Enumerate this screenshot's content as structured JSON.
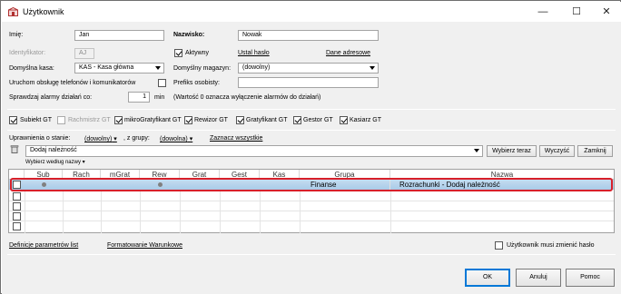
{
  "window": {
    "title": "Użytkownik",
    "minimize": "—",
    "maximize": "☐",
    "close": "✕"
  },
  "form": {
    "imie_label": "Imię:",
    "imie_value": "Jan",
    "nazwisko_label": "Nazwisko:",
    "nazwisko_value": "Nowak",
    "identyfikator_label": "Identyfikator:",
    "identyfikator_value": "AJ",
    "aktywny_label": "Aktywny",
    "ustal_haslo": "Ustal hasło",
    "dane_adresowe": "Dane adresowe",
    "kasa_label": "Domyślna kasa:",
    "kasa_value": "KAS - Kasa główna",
    "magazyn_label": "Domyślny magazyn:",
    "magazyn_value": "(dowolny)",
    "telefony_label": "Uruchom obsługę telefonów i komunikatorów",
    "prefiks_label": "Prefiks osobisty:",
    "alarmy_label": "Sprawdzaj alarmy działań co:",
    "alarmy_value": "1",
    "alarmy_unit": "min",
    "alarmy_note": "(Wartość 0 oznacza wyłączenie alarmów do działań)"
  },
  "roles": [
    {
      "label": "Subiekt GT",
      "checked": true,
      "enabled": true
    },
    {
      "label": "Rachmistrz GT",
      "checked": false,
      "enabled": false
    },
    {
      "label": "mikroGratyfikant GT",
      "checked": true,
      "enabled": true
    },
    {
      "label": "Rewizor GT",
      "checked": true,
      "enabled": true
    },
    {
      "label": "Gratyfikant GT",
      "checked": true,
      "enabled": true
    },
    {
      "label": "Gestor GT",
      "checked": true,
      "enabled": true
    },
    {
      "label": "Kasiarz GT",
      "checked": true,
      "enabled": true
    }
  ],
  "permissions": {
    "label": "Uprawnienia o stanie:",
    "state_value": "(dowolny)",
    "group_label": ", z grupy:",
    "group_value": "(dowolna)",
    "select_all": "Zaznacz wszystkie",
    "action_value": "Dodaj należność",
    "wybierz_teraz": "Wybierz teraz",
    "wyczysc": "Wyczyść",
    "zamknij": "Zamknij",
    "wybierz_wedlug": "Wybierz według nazwy"
  },
  "grid": {
    "columns": [
      "Sub",
      "Rach",
      "mGrat",
      "Rew",
      "Grat",
      "Gest",
      "Kas",
      "Grupa",
      "Nazwa"
    ],
    "rows": [
      {
        "sub": true,
        "rach": false,
        "mgrat": false,
        "rew": true,
        "grat": false,
        "gest": false,
        "kas": false,
        "grupa": "Finanse",
        "nazwa": "Rozrachunki - Dodaj należność",
        "selected": true
      }
    ]
  },
  "footer": {
    "definicje": "Definicje parametrów list",
    "formatowanie": "Formatowanie Warunkowe",
    "musi_zmienic": "Użytkownik musi zmienić hasło",
    "ok": "OK",
    "anuluj": "Anuluj",
    "pomoc": "Pomoc"
  }
}
